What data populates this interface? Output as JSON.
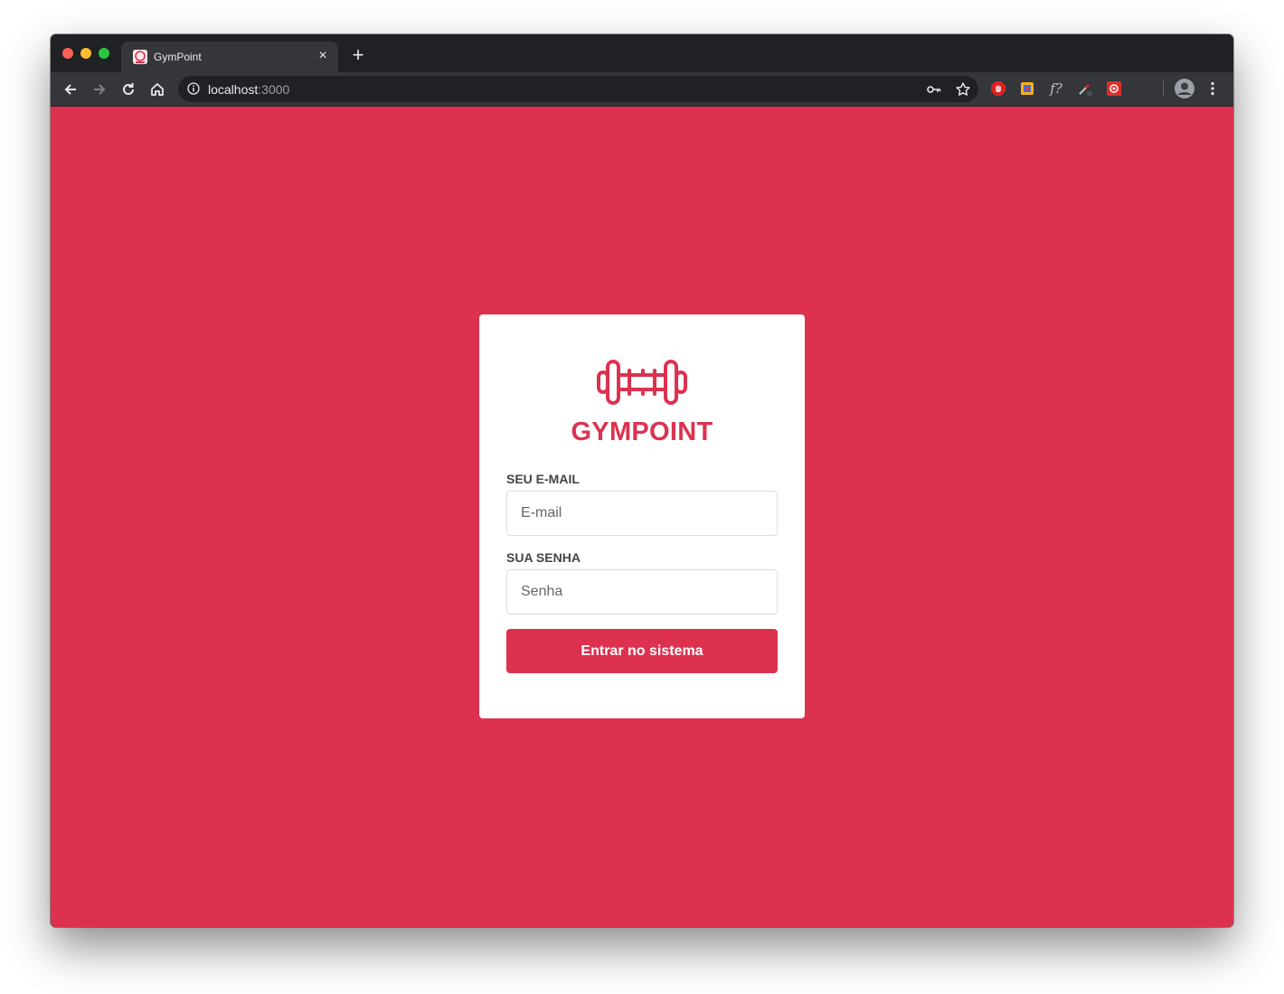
{
  "browser": {
    "tab": {
      "title": "GymPoint",
      "close_symbol": "×"
    },
    "new_tab_symbol": "+",
    "address": {
      "host": "localhost",
      "port": ":3000"
    },
    "theme": {
      "frame": "#202124",
      "toolbar": "#35363a"
    }
  },
  "login": {
    "brand": "GYMPOINT",
    "email_label": "SEU E-MAIL",
    "email_placeholder": "E-mail",
    "email_value": "",
    "password_label": "SUA SENHA",
    "password_placeholder": "Senha",
    "password_value": "",
    "submit_label": "Entrar no sistema",
    "logo_icon": "dumbbell-icon"
  },
  "colors": {
    "accent": "#dc3250",
    "card": "#ffffff",
    "label_text": "#444444"
  }
}
